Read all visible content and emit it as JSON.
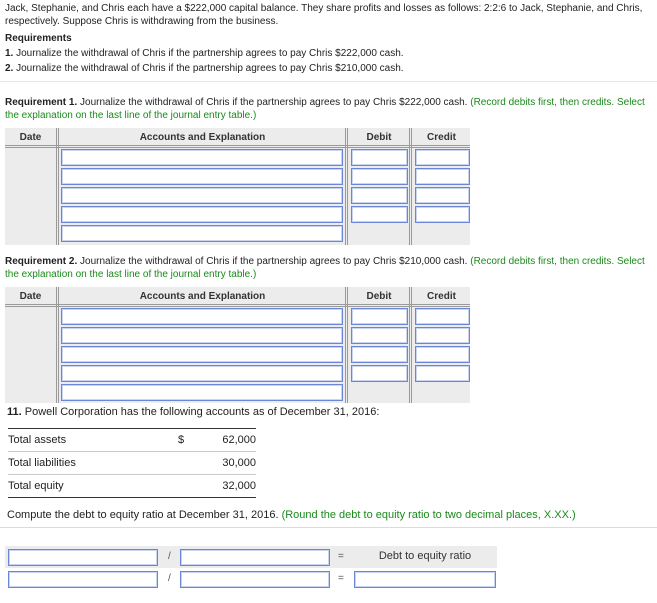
{
  "intro": {
    "text": "Jack, Stephanie, and Chris each have a $222,000 capital balance. They share profits and losses as follows: 2:2:6 to Jack, Stephanie, and Chris, respectively. Suppose Chris is withdrawing from the business."
  },
  "requirements": {
    "title": "Requirements",
    "items": [
      {
        "num": "1.",
        "text": "Journalize the withdrawal of Chris if the partnership agrees to pay Chris $222,000 cash."
      },
      {
        "num": "2.",
        "text": "Journalize the withdrawal of Chris if the partnership agrees to pay Chris $210,000 cash."
      }
    ]
  },
  "req1": {
    "label": "Requirement 1.",
    "text": "Journalize the withdrawal of Chris if the partnership agrees to pay Chris $222,000 cash.",
    "hint": "(Record debits first, then credits. Select the explanation on the last line of the journal entry table.)"
  },
  "req2": {
    "label": "Requirement 2.",
    "text": "Journalize the withdrawal of Chris if the partnership agrees to pay Chris $210,000 cash.",
    "hint": "(Record debits first, then credits. Select the explanation on the last line of the journal entry table.)"
  },
  "journal_columns": {
    "date": "Date",
    "accounts": "Accounts and Explanation",
    "debit": "Debit",
    "credit": "Credit"
  },
  "journal1": {
    "rows": [
      {
        "account": "",
        "debit": "",
        "credit": ""
      },
      {
        "account": "",
        "debit": "",
        "credit": ""
      },
      {
        "account": "",
        "debit": "",
        "credit": ""
      },
      {
        "account": "",
        "debit": "",
        "credit": ""
      },
      {
        "explanation": ""
      }
    ]
  },
  "journal2": {
    "rows": [
      {
        "account": "",
        "debit": "",
        "credit": ""
      },
      {
        "account": "",
        "debit": "",
        "credit": ""
      },
      {
        "account": "",
        "debit": "",
        "credit": ""
      },
      {
        "account": "",
        "debit": "",
        "credit": ""
      },
      {
        "explanation": ""
      }
    ]
  },
  "q11": {
    "num": "11.",
    "text": "Powell Corporation has the following accounts as of December 31, 2016:",
    "accounts": [
      {
        "label": "Total assets",
        "currency": "$",
        "value": "62,000"
      },
      {
        "label": "Total liabilities",
        "currency": "",
        "value": "30,000"
      },
      {
        "label": "Total equity",
        "currency": "",
        "value": "32,000"
      }
    ],
    "prompt": "Compute the debt to equity ratio at December 31, 2016.",
    "hint": "(Round the debt to equity ratio to two decimal places, X.XX.)"
  },
  "ratio": {
    "divide_symbol": "/",
    "equals_symbol": "=",
    "result_label": "Debt to equity ratio",
    "row1": {
      "numerator": "",
      "denominator": ""
    },
    "row2": {
      "numerator": "",
      "denominator": "",
      "result": ""
    }
  }
}
